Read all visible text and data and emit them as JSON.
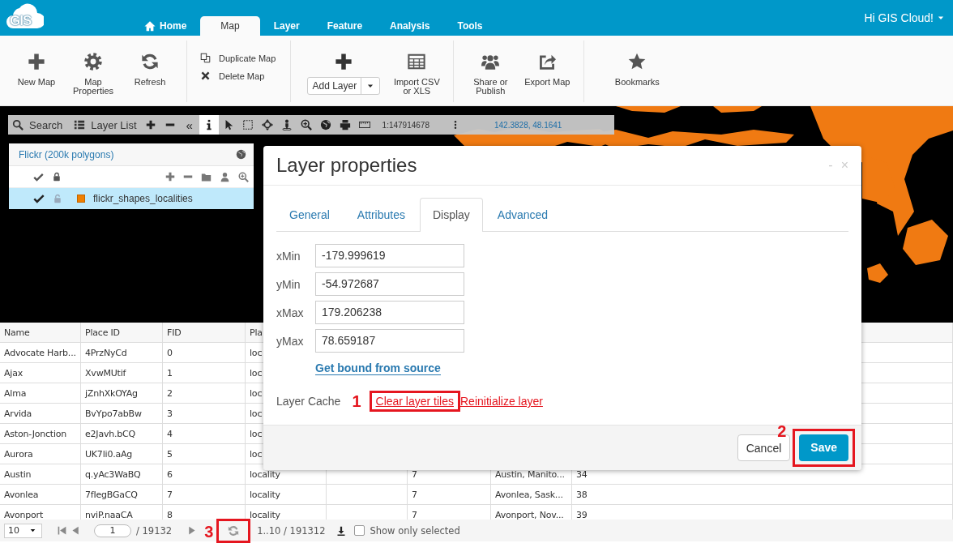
{
  "header": {
    "logo": "GIS",
    "nav": [
      {
        "label": "Home",
        "selected": false
      },
      {
        "label": "Map",
        "selected": true
      },
      {
        "label": "Layer",
        "selected": false
      },
      {
        "label": "Feature",
        "selected": false
      },
      {
        "label": "Analysis",
        "selected": false
      },
      {
        "label": "Tools",
        "selected": false
      }
    ],
    "user_menu": "Hi GIS Cloud!"
  },
  "ribbon": {
    "groups": [
      {
        "items": [
          {
            "kind": "big",
            "label": "New Map"
          },
          {
            "kind": "big",
            "label": "Map Properties"
          },
          {
            "kind": "big",
            "label": "Refresh"
          }
        ]
      },
      {
        "items": [
          {
            "kind": "small",
            "label": "Duplicate Map"
          },
          {
            "kind": "small",
            "label": "Delete Map"
          }
        ]
      },
      {
        "items": [
          {
            "kind": "dropdown",
            "label": "Add Layer"
          },
          {
            "kind": "big",
            "label": "Import CSV or XLS"
          }
        ]
      },
      {
        "items": [
          {
            "kind": "big",
            "label": "Share or Publish"
          },
          {
            "kind": "big",
            "label": "Export Map"
          }
        ]
      },
      {
        "items": [
          {
            "kind": "big",
            "label": "Bookmarks"
          }
        ]
      }
    ]
  },
  "map_toolbar": {
    "search": "Search",
    "layer_list": "Layer List",
    "collapse": "«",
    "tools": [
      {
        "selected": true
      },
      {
        "selected": false
      },
      {
        "selected": false
      },
      {
        "selected": false
      },
      {
        "selected": false
      },
      {
        "selected": false
      },
      {
        "selected": false
      },
      {
        "selected": false
      },
      {
        "selected": false
      }
    ],
    "scale": "1:147914678",
    "coordinates": "142.3828, 48.1641"
  },
  "layer_panel": {
    "title": "Flickr (200k polygons)",
    "layers": [
      {
        "name": "flickr_shapes_localities",
        "visible": true,
        "locked": false,
        "selected": true,
        "color": "#f07f00"
      }
    ]
  },
  "table": {
    "columns": [
      "Name",
      "Place ID",
      "FID",
      "Pla"
    ],
    "rows": [
      {
        "name": "Advocate Harb...",
        "place_id": "4PrzNyCd",
        "fid": "0",
        "column_4": "loc"
      },
      {
        "name": "Ajax",
        "place_id": "XvwMUtif",
        "fid": "1",
        "column_4": "loc"
      },
      {
        "name": "Alma",
        "place_id": "jZnhXkOYAg",
        "fid": "2",
        "column_4": "loc"
      },
      {
        "name": "Arvida",
        "place_id": "BvYpo7abBw",
        "fid": "3",
        "column_4": "loc"
      },
      {
        "name": "Aston-Jonction",
        "place_id": "e2Javh.bCQ",
        "fid": "4",
        "column_4": "loc"
      },
      {
        "name": "Aurora",
        "place_id": "UK7li0.aAg",
        "fid": "5",
        "column_4": "loc"
      },
      {
        "name": "Austin",
        "place_id": "q.yAc3WaBQ",
        "fid": "6",
        "column_4": "locality",
        "column_6": "7",
        "column_7": "Austin, Manito...",
        "column_8": "34"
      },
      {
        "name": "Avonlea",
        "place_id": "7fIegBGaCQ",
        "fid": "7",
        "column_4": "locality",
        "column_6": "7",
        "column_7": "Avonlea, Sask...",
        "column_8": "38"
      },
      {
        "name": "Avonport",
        "place_id": "nviP.naaCA",
        "fid": "8",
        "column_4": "locality",
        "column_6": "7",
        "column_7": "Avonport, Nov...",
        "column_8": "39"
      }
    ]
  },
  "footer": {
    "page_size": "10",
    "page": "1",
    "page_total": "/ 19132",
    "range": "1..10 / 191312",
    "show_only_selected": {
      "label": "Show only selected",
      "checked": false
    }
  },
  "modal": {
    "title": "Layer properties",
    "minimize": "-",
    "close": "×",
    "tabs": [
      {
        "label": "General",
        "selected": false
      },
      {
        "label": "Attributes",
        "selected": false
      },
      {
        "label": "Display",
        "selected": true
      },
      {
        "label": "Advanced",
        "selected": false
      }
    ],
    "fields": [
      {
        "label": "xMin",
        "value": "-179.999619"
      },
      {
        "label": "yMin",
        "value": "-54.972687"
      },
      {
        "label": "xMax",
        "value": "179.206238"
      },
      {
        "label": "yMax",
        "value": "78.659187"
      }
    ],
    "bound_link": "Get bound from source",
    "cache_label": "Layer Cache",
    "cache_actions": [
      "Clear layer tiles",
      "Reinitialize layer"
    ],
    "buttons": [
      {
        "label": "Cancel",
        "kind": "default"
      },
      {
        "label": "Save",
        "kind": "primary"
      }
    ]
  },
  "annotations": [
    {
      "label": "1"
    },
    {
      "label": "2"
    },
    {
      "label": "3"
    }
  ]
}
